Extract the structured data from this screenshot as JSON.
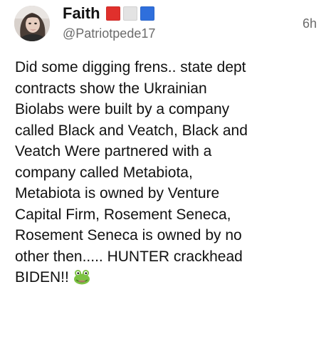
{
  "post": {
    "author": {
      "display_name": "Faith",
      "username": "@Patriotpede17",
      "name_emoji": {
        "icon": "flag-squares-icon",
        "colors": [
          "#e0302c",
          "#e3e3e3",
          "#2f6fdc"
        ]
      },
      "avatar_icon": "user-avatar-photo"
    },
    "timestamp": "6h",
    "body_lines": [
      "Did some digging frens.. state dept",
      "contracts show the Ukrainian",
      "Biolabs were built by a company",
      "called Black and Veatch, Black and",
      "Veatch Were partnered with a",
      "company called Metabiota,",
      "Metabiota is owned by Venture",
      "Capital Firm, Rosement Seneca,",
      "Rosement Seneca is owned by no",
      "other then..... HUNTER crackhead",
      "BIDEN!!"
    ],
    "trailing_emoji": "frog-face-icon"
  },
  "colors": {
    "text_primary": "#111111",
    "text_secondary": "#6b6b6b",
    "background": "#ffffff"
  }
}
